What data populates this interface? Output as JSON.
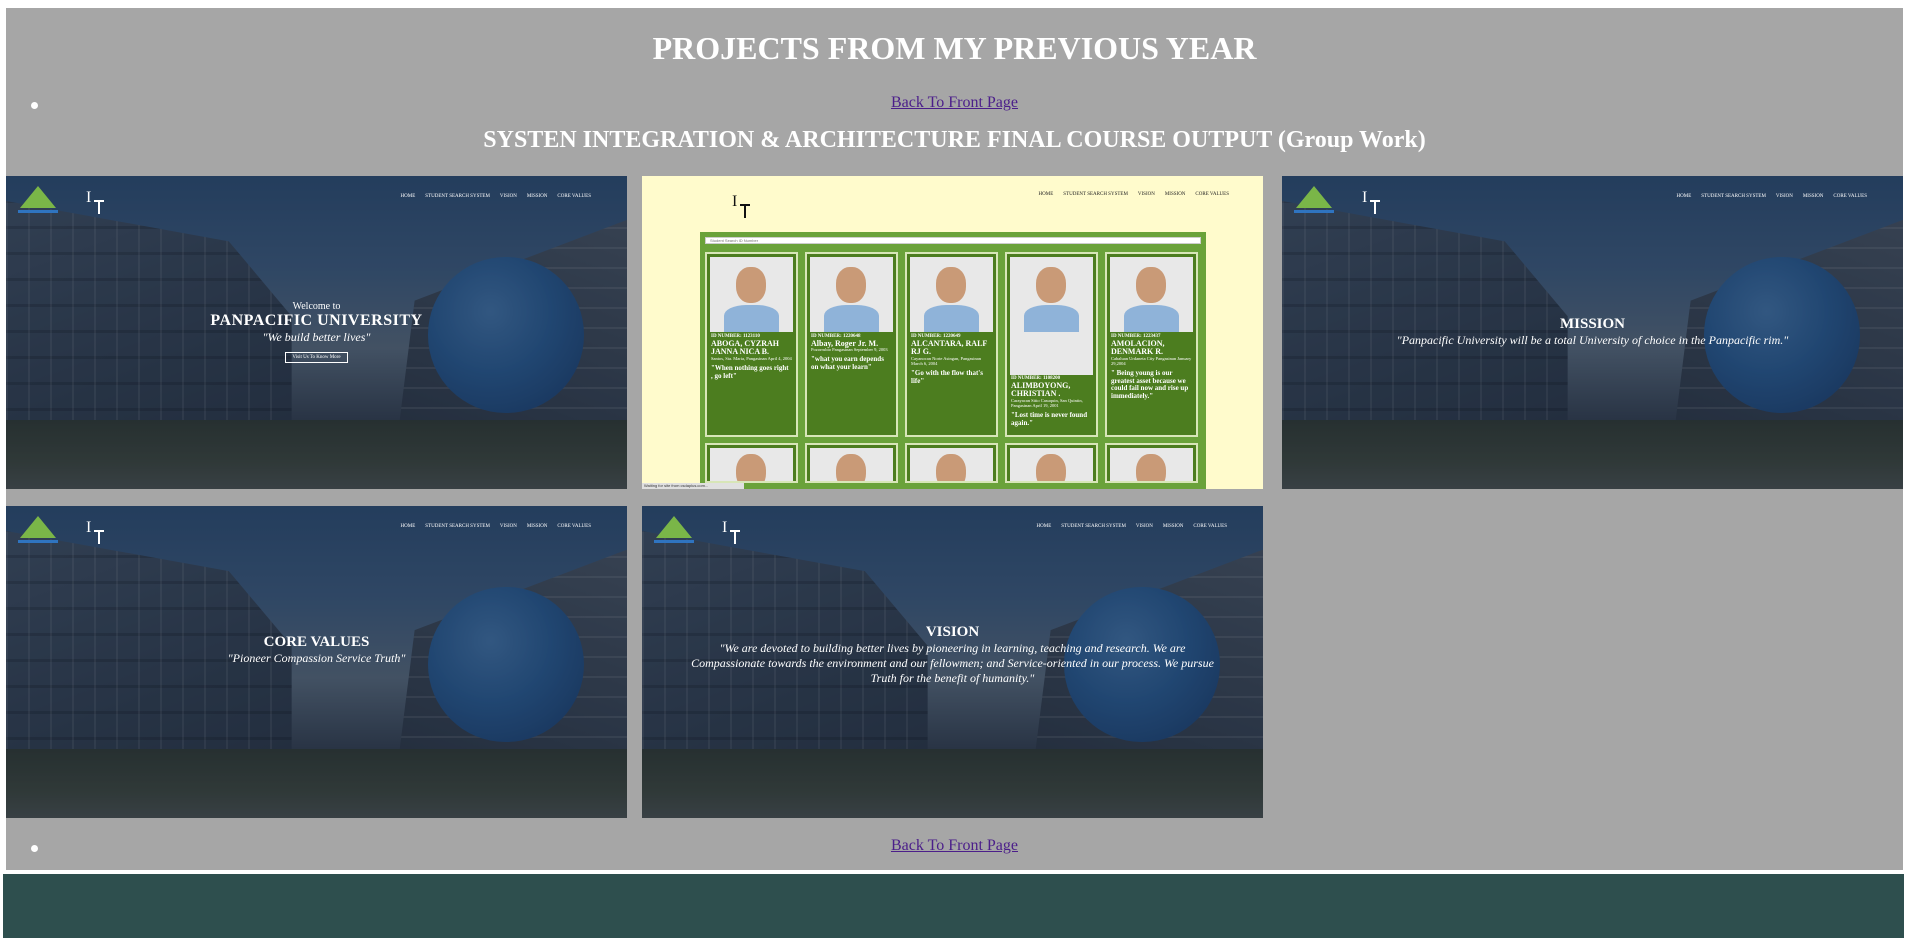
{
  "page": {
    "title": "PROJECTS FROM MY PREVIOUS YEAR",
    "back_link": "Back To Front Page",
    "section_title": "SYSTEN INTEGRATION & ARCHITECTURE FINAL COURSE OUTPUT (Group Work)"
  },
  "colors": {
    "main_bg": "#a6a6a6",
    "footer_bg": "#2e4f4e",
    "link": "#4b1e8a",
    "panel_green": "#6aa23a",
    "card_green": "#4c7d1f"
  },
  "site_nav": [
    "HOME",
    "STUDENT SEARCH SYSTEM",
    "VISION",
    "MISSION",
    "CORE VALUES"
  ],
  "logo_letter": "I",
  "screenshots": {
    "home": {
      "welcome": "Welcome to",
      "name": "PANPACIFIC UNIVERSITY",
      "motto": "\"We build better lives\"",
      "button": "Visit Us To Know More"
    },
    "search": {
      "placeholder": "Student Search ID Number",
      "status": "Waiting for site from csdaplus.com...",
      "students": [
        {
          "id": "ID NUMBER: 1123110",
          "name": "ABOGA, CYZRAH JANNA NICA B.",
          "addr": "Santos, Sta. Maria, Pangasinan April 4, 2004",
          "quote": "\"When nothing goes right , go left\""
        },
        {
          "id": "ID NUMBER: 1220648",
          "name": "Albay, Roger Jr. M.",
          "addr": "Pozorrubio Pangasinan September 9, 2003",
          "quote": "\"what you earn depends on what your learn\""
        },
        {
          "id": "ID NUMBER: 1220649",
          "name": "ALCANTARA, RALF RJ G.",
          "addr": "Cayanocan Norte Asingan, Pangasinan March 6, 2004",
          "quote": "\"Go with the flow that's life\""
        },
        {
          "id": "ID NUMBER: 1108200",
          "name": "ALIMBOYONG, CHRISTIAN .",
          "addr": "Carayacan Sitio Casuquin, San Quintin, Pangasinan April 19, 2001",
          "quote": "\"Lost time is never found again.\""
        },
        {
          "id": "ID NUMBER: 1223437",
          "name": "AMOLACION, DENMARK R.",
          "addr": "Cabaluan Urdaneta City Pangasinan January 29,2004",
          "quote": "\" Being young is our greatest asset because we could fail now and rise up immediately.\""
        }
      ]
    },
    "mission": {
      "title": "MISSION",
      "text": "\"Panpacific University will be a total University of choice in the Panpacific rim.\""
    },
    "core_values": {
      "title": "CORE VALUES",
      "text": "\"Pioneer Compassion Service Truth\""
    },
    "vision": {
      "title": "VISION",
      "text": "\"We are devoted to building better lives by pioneering in learning, teaching and research. We are Compassionate towards the environment and our fellowmen; and Service-oriented in our process. We pursue Truth for the benefit of humanity.\""
    }
  }
}
